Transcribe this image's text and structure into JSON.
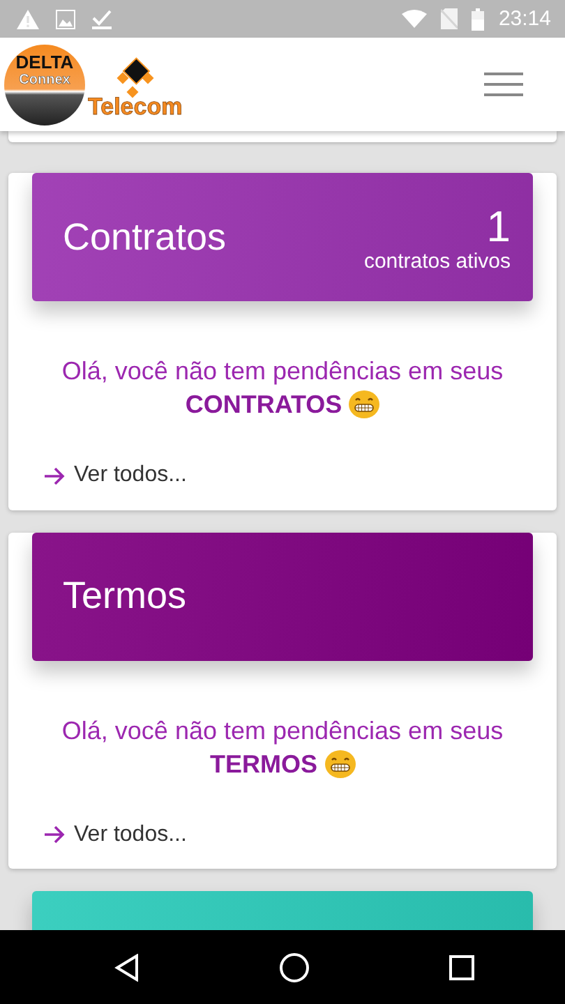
{
  "status_bar": {
    "time": "23:14"
  },
  "logo": {
    "line_1": "DELTA",
    "line_2": "Connex",
    "word": "Telecom"
  },
  "cards": [
    {
      "title": "Contratos",
      "count": "1",
      "count_label": "contratos ativos",
      "message": "Olá, você não tem pendências em seus",
      "highlight": "CONTRATOS",
      "link": "Ver todos...",
      "color": "#9a32b0"
    },
    {
      "title": "Termos",
      "message": "Olá, você não tem pendências em seus",
      "highlight": "TERMOS",
      "link": "Ver todos...",
      "color": "#7f0080"
    },
    {
      "color": "#2bcbba"
    }
  ]
}
